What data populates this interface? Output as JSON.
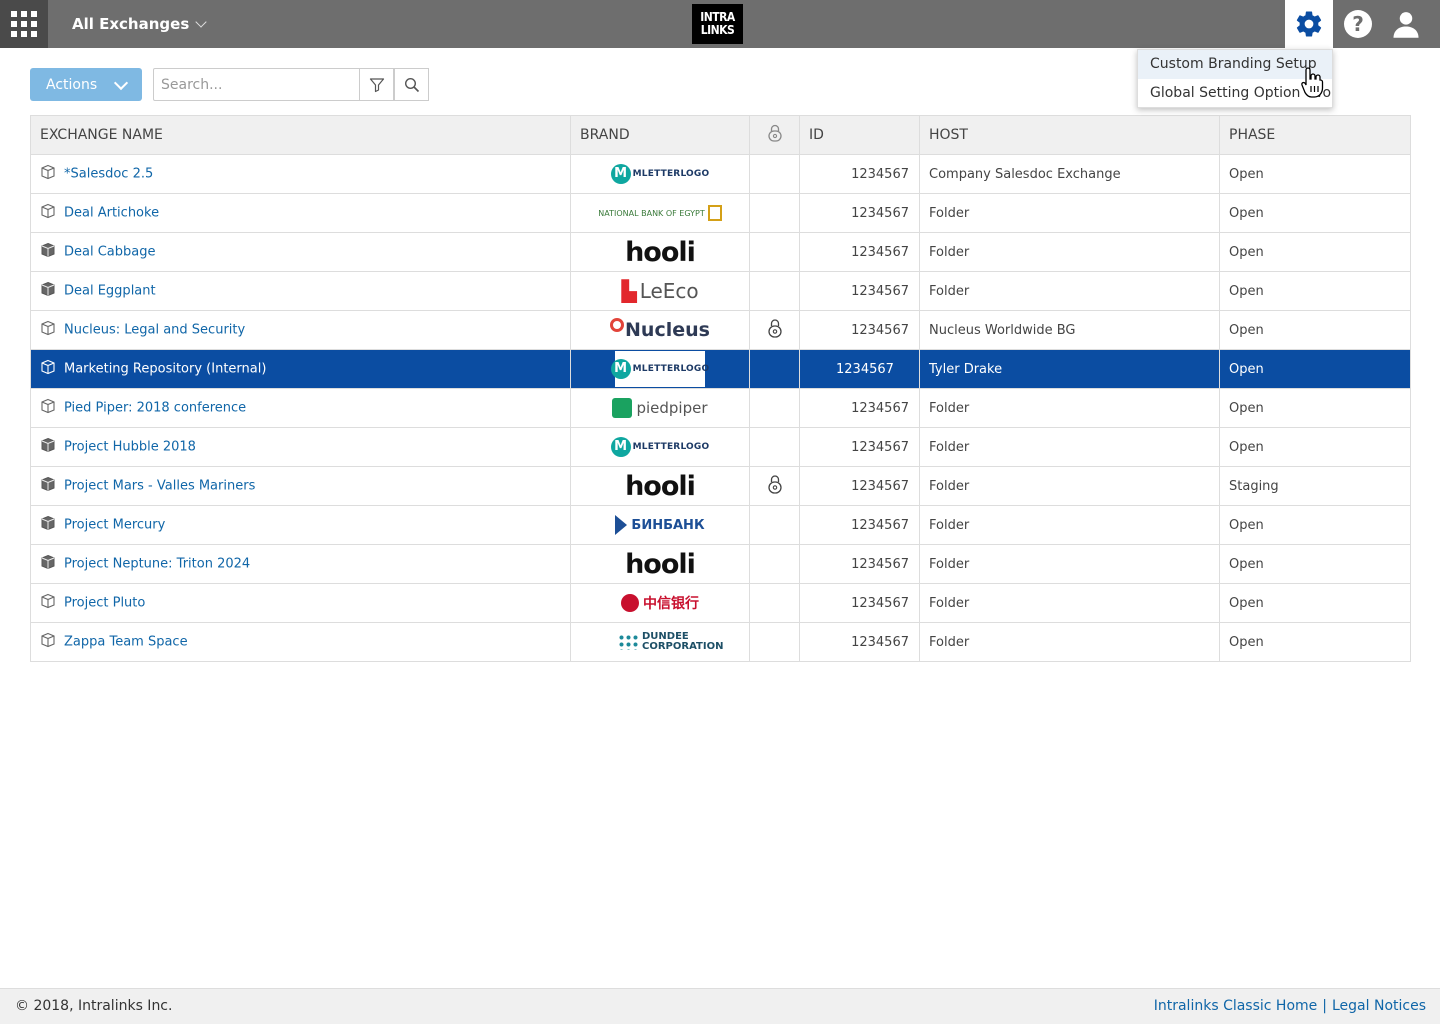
{
  "header": {
    "exchange_switcher": "All Exchanges",
    "logo_line1": "INTRA",
    "logo_line2": "LINKS",
    "help_glyph": "?"
  },
  "settings_menu": {
    "items": [
      "Custom Branding Setup",
      "Global Setting Option Two"
    ]
  },
  "toolbar": {
    "actions_label": "Actions",
    "search_placeholder": "Search..."
  },
  "table": {
    "columns": [
      "EXCHANGE NAME",
      "BRAND",
      "",
      "ID",
      "HOST",
      "PHASE"
    ],
    "rows": [
      {
        "name": "*Salesdoc 2.5",
        "brand": "MLETTERLOGO",
        "locked": false,
        "id": "1234567",
        "host": "Company Salesdoc Exchange",
        "phase": "Open",
        "icon": "box-outline-icon"
      },
      {
        "name": "Deal Artichoke",
        "brand": "NATIONAL BANK OF EGYPT",
        "locked": false,
        "id": "1234567",
        "host": "Folder",
        "phase": "Open",
        "icon": "box-outline-icon"
      },
      {
        "name": "Deal Cabbage",
        "brand": "hooli",
        "locked": false,
        "id": "1234567",
        "host": "Folder",
        "phase": "Open",
        "icon": "box-filled-icon"
      },
      {
        "name": "Deal Eggplant",
        "brand": "LeEco",
        "locked": false,
        "id": "1234567",
        "host": "Folder",
        "phase": "Open",
        "icon": "box-filled-icon"
      },
      {
        "name": "Nucleus: Legal and Security",
        "brand": "Nucleus",
        "locked": true,
        "id": "1234567",
        "host": "Nucleus Worldwide BG",
        "phase": "Open",
        "icon": "box-outline-icon"
      },
      {
        "name": "Marketing Repository (Internal)",
        "brand": "MLETTERLOGO",
        "locked": false,
        "id": "1234567",
        "host": "Tyler Drake",
        "phase": "Open",
        "icon": "box-outline-icon",
        "selected": true
      },
      {
        "name": "Pied Piper: 2018 conference",
        "brand": "piedpiper",
        "locked": false,
        "id": "1234567",
        "host": "Folder",
        "phase": "Open",
        "icon": "box-outline-icon"
      },
      {
        "name": "Project Hubble 2018",
        "brand": "MLETTERLOGO",
        "locked": false,
        "id": "1234567",
        "host": "Folder",
        "phase": "Open",
        "icon": "box-filled-icon"
      },
      {
        "name": "Project Mars - Valles Mariners",
        "brand": "hooli",
        "locked": true,
        "id": "1234567",
        "host": "Folder",
        "phase": "Staging",
        "icon": "box-filled-icon"
      },
      {
        "name": "Project Mercury",
        "brand": "БИНБАНК",
        "locked": false,
        "id": "1234567",
        "host": "Folder",
        "phase": "Open",
        "icon": "box-filled-icon"
      },
      {
        "name": "Project Neptune: Triton 2024",
        "brand": "hooli",
        "locked": false,
        "id": "1234567",
        "host": "Folder",
        "phase": "Open",
        "icon": "box-filled-icon"
      },
      {
        "name": "Project Pluto",
        "brand": "中信银行",
        "locked": false,
        "id": "1234567",
        "host": "Folder",
        "phase": "Open",
        "icon": "box-outline-icon"
      },
      {
        "name": "Zappa Team Space",
        "brand": "DUNDEE CORPORATION",
        "locked": false,
        "id": "1234567",
        "host": "Folder",
        "phase": "Open",
        "icon": "box-outline-icon"
      }
    ]
  },
  "footer": {
    "copyright": "© 2018, Intralinks Inc.",
    "link_classic": "Intralinks Classic Home",
    "separator": "|",
    "link_legal": "Legal Notices"
  },
  "colors": {
    "topbar": "#6e6e6e",
    "accent_blue": "#0b4da2",
    "link_blue": "#1066a8",
    "actions_button": "#7fb9e3"
  }
}
